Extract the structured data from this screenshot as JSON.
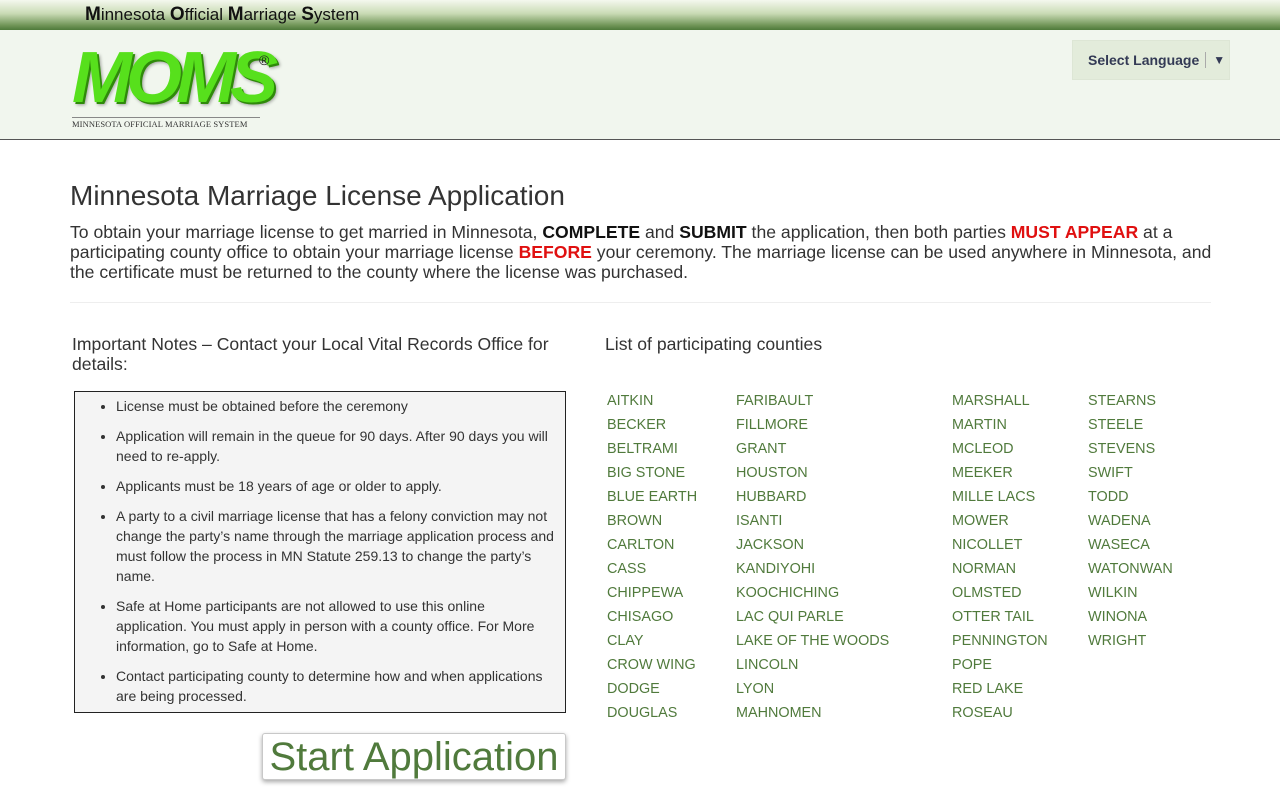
{
  "topbar": {
    "title_words": [
      {
        "cap": "M",
        "rest": "innesota "
      },
      {
        "cap": "O",
        "rest": "fficial "
      },
      {
        "cap": "M",
        "rest": "arriage "
      },
      {
        "cap": "S",
        "rest": "ystem"
      }
    ]
  },
  "logo": {
    "text": "MOMS",
    "reg": "®",
    "subtitle": "MINNESOTA OFFICIAL MARRIAGE SYSTEM",
    "color": "#57e01c"
  },
  "language": {
    "label": "Select Language",
    "arrow": "▼"
  },
  "main": {
    "title": "Minnesota Marriage License Application",
    "intro": {
      "p1": "To obtain your marriage license to get married in Minnesota, ",
      "b1": "COMPLETE",
      "p2": " and ",
      "b2": "SUBMIT",
      "p3": " the application, then both parties ",
      "r1": "MUST APPEAR",
      "p4": " at a participating county office to obtain your marriage license ",
      "r2": "BEFORE",
      "p5": " your ceremony. The marriage license can be used anywhere in Minnesota, and the certificate must be returned to the county where the license was purchased."
    }
  },
  "notes": {
    "heading": "Important Notes – Contact your Local Vital Records Office for details:",
    "items": [
      "License must be obtained before the ceremony",
      "Application will remain in the queue for 90 days. After 90 days you will need to re-apply.",
      "Applicants must be 18 years of age or older to apply.",
      "A party to a civil marriage license that has a felony conviction may not change the party’s name through the marriage application process and must follow the process in MN Statute 259.13 to change the party’s name.",
      "Safe at Home participants are not allowed to use this online application. You must apply in person with a county office. For More information, go to Safe at Home.",
      "Contact participating county to determine how and when applications are being processed."
    ]
  },
  "start_button": {
    "label": "Start Application"
  },
  "counties": {
    "heading": "List of participating counties",
    "columns": [
      [
        "AITKIN",
        "BECKER",
        "BELTRAMI",
        "BIG STONE",
        "BLUE EARTH",
        "BROWN",
        "CARLTON",
        "CASS",
        "CHIPPEWA",
        "CHISAGO",
        "CLAY",
        "CROW WING",
        "DODGE",
        "DOUGLAS"
      ],
      [
        "FARIBAULT",
        "FILLMORE",
        "GRANT",
        "HOUSTON",
        "HUBBARD",
        "ISANTI",
        "JACKSON",
        "KANDIYOHI",
        "KOOCHICHING",
        "LAC QUI PARLE",
        "LAKE OF THE WOODS",
        "LINCOLN",
        "LYON",
        "MAHNOMEN"
      ],
      [
        "MARSHALL",
        "MARTIN",
        "MCLEOD",
        "MEEKER",
        "MILLE LACS",
        "MOWER",
        "NICOLLET",
        "NORMAN",
        "OLMSTED",
        "OTTER TAIL",
        "PENNINGTON",
        "POPE",
        "RED LAKE",
        "ROSEAU"
      ],
      [
        "STEARNS",
        "STEELE",
        "STEVENS",
        "SWIFT",
        "TODD",
        "WADENA",
        "WASECA",
        "WATONWAN",
        "WILKIN",
        "WINONA",
        "WRIGHT"
      ]
    ],
    "link_color": "#507a3c"
  }
}
